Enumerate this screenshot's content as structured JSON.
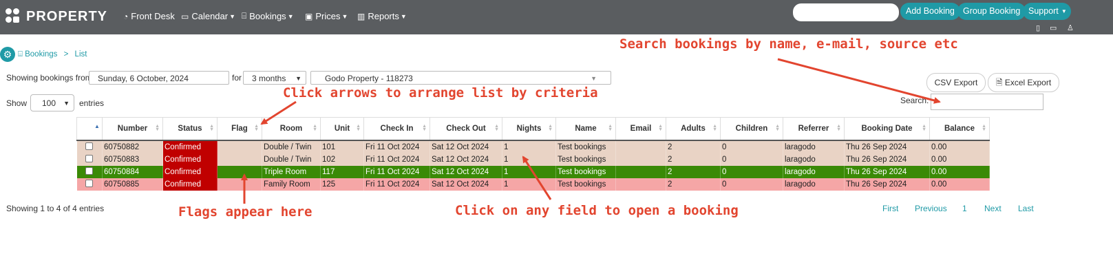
{
  "header": {
    "brand": "PROPERTY",
    "nav": [
      {
        "label": "Front Desk",
        "icon": "dashboard-icon"
      },
      {
        "label": "Calendar",
        "icon": "calendar-icon"
      },
      {
        "label": "Bookings",
        "icon": "bed-icon"
      },
      {
        "label": "Prices",
        "icon": "money-icon"
      },
      {
        "label": "Reports",
        "icon": "bar-chart-icon"
      }
    ],
    "search_value": "",
    "add_booking": "Add Booking",
    "group_booking": "Group Booking",
    "support": "Support"
  },
  "breadcrumb": {
    "parent": "Bookings",
    "current": "List"
  },
  "filters": {
    "showing_from_label": "Showing bookings from",
    "date": "Sunday, 6 October, 2024",
    "for_label": "for",
    "period": "3 months",
    "property": "Godo Property - 118273",
    "show_label": "Show",
    "entries_count": "100",
    "entries_label": "entries",
    "search_label": "Search:",
    "csv_export": "CSV Export",
    "excel_export": "Excel Export"
  },
  "table": {
    "columns": [
      "",
      "Number",
      "Status",
      "Flag",
      "Room",
      "Unit",
      "Check In",
      "Check Out",
      "Nights",
      "Name",
      "Email",
      "Adults",
      "Children",
      "Referrer",
      "Booking Date",
      "Balance"
    ],
    "rows": [
      {
        "style": "beige",
        "cells": [
          "60750882",
          "Confirmed",
          "",
          "Double / Twin",
          "101",
          "Fri 11 Oct 2024",
          "Sat 12 Oct 2024",
          "1",
          "Test bookings",
          "",
          "2",
          "0",
          "laragodo",
          "Thu 26 Sep 2024",
          "0.00"
        ]
      },
      {
        "style": "beige",
        "cells": [
          "60750883",
          "Confirmed",
          "",
          "Double / Twin",
          "102",
          "Fri 11 Oct 2024",
          "Sat 12 Oct 2024",
          "1",
          "Test bookings",
          "",
          "2",
          "0",
          "laragodo",
          "Thu 26 Sep 2024",
          "0.00"
        ]
      },
      {
        "style": "green",
        "cells": [
          "60750884",
          "Confirmed",
          "",
          "Triple Room",
          "117",
          "Fri 11 Oct 2024",
          "Sat 12 Oct 2024",
          "1",
          "Test bookings",
          "",
          "2",
          "0",
          "laragodo",
          "Thu 26 Sep 2024",
          "0.00"
        ]
      },
      {
        "style": "pink",
        "cells": [
          "60750885",
          "Confirmed",
          "",
          "Family Room",
          "125",
          "Fri 11 Oct 2024",
          "Sat 12 Oct 2024",
          "1",
          "Test bookings",
          "",
          "2",
          "0",
          "laragodo",
          "Thu 26 Sep 2024",
          "0.00"
        ]
      }
    ]
  },
  "footer": {
    "info": "Showing 1 to 4 of 4 entries",
    "first": "First",
    "previous": "Previous",
    "page": "1",
    "next": "Next",
    "last": "Last"
  },
  "annotations": {
    "search": "Search bookings by name, e-mail, source etc",
    "arrows": "Click arrows to arrange list by criteria",
    "flags": "Flags appear here",
    "field": "Click on any field to open a booking"
  },
  "colors": {
    "accent": "#1f9aa6",
    "annotation": "#e2452f",
    "status_confirmed": "#c00000",
    "row_green": "#3a8a06",
    "row_pink": "#f5a6a6",
    "row_beige": "#e9d3c5"
  }
}
